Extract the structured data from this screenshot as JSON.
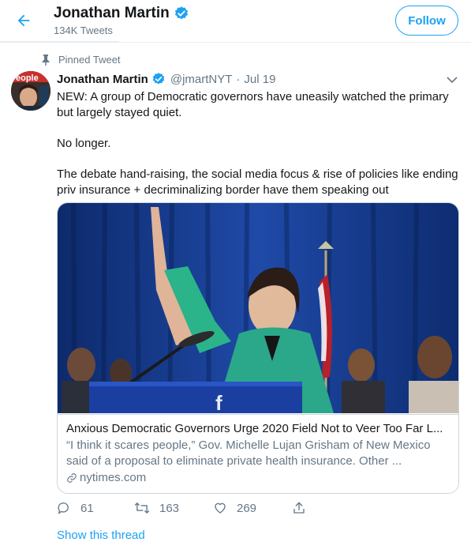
{
  "header": {
    "name": "Jonathan Martin",
    "tweet_count": "134K Tweets",
    "follow_label": "Follow",
    "back_icon": "arrow-left-icon",
    "accent_color": "#1da1f2"
  },
  "tweet": {
    "pinned_label": "Pinned Tweet",
    "name": "Jonathan Martin",
    "handle": "@jmartNYT",
    "separator": "·",
    "date": "Jul 19",
    "text": [
      "NEW: A group of Democratic governors have uneasily watched the primary but largely stayed quiet.",
      "No longer.",
      "The debate hand-raising, the social media focus & rise of policies like ending priv insurance + decriminalizing border have them speaking out"
    ],
    "card": {
      "title": "Anxious Democratic Governors Urge 2020 Field Not to Veer Too Far L...",
      "description": "“I think it scares people,” Gov. Michelle Lujan Grisham of New Mexico said of a proposal to eliminate private health insurance. Other ...",
      "domain": "nytimes.com"
    },
    "actions": {
      "replies": "61",
      "retweets": "163",
      "likes": "269"
    },
    "show_thread": "Show this thread"
  }
}
